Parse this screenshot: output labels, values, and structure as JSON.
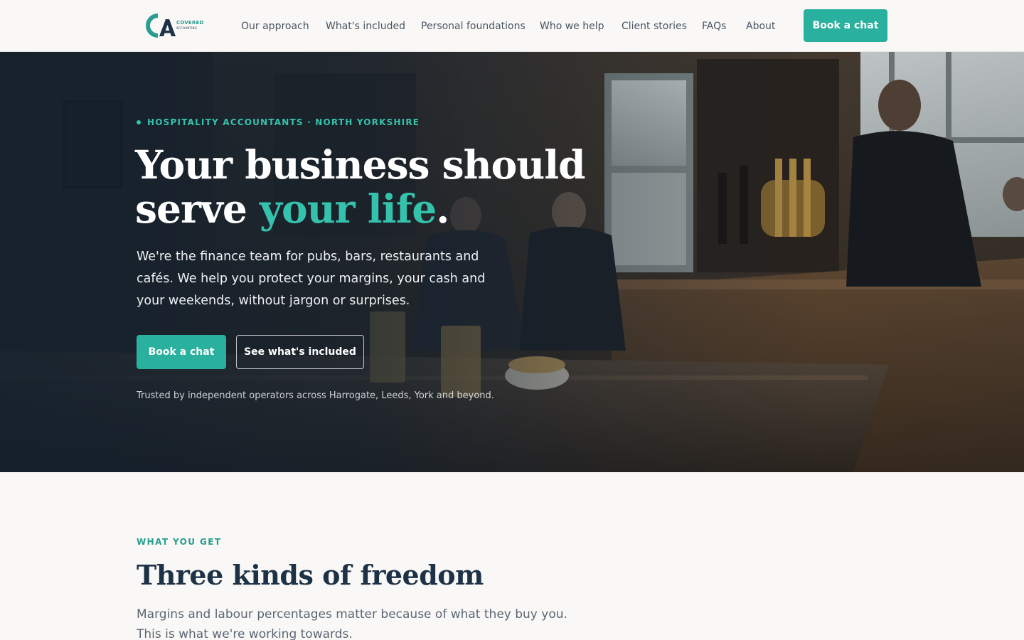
{
  "brand": {
    "monogram": "CA",
    "name": "COVERED",
    "tagline": "ACCOUNTING"
  },
  "nav": {
    "items": [
      {
        "label": "Our approach"
      },
      {
        "label": "What's included"
      },
      {
        "label": "Personal foundations"
      },
      {
        "label": "Who we help"
      },
      {
        "label": "Client stories"
      },
      {
        "label": "FAQs"
      },
      {
        "label": "About"
      }
    ],
    "cta_label": "Book a chat"
  },
  "hero": {
    "eyebrow": "HOSPITALITY ACCOUNTANTS · NORTH YORKSHIRE",
    "title_line1": "Your business should",
    "title_line2_start": "serve ",
    "title_accent": "your life",
    "title_end": ".",
    "lead": "We're the finance team for pubs, bars, restaurants and cafés. We help you protect your margins, your cash and your weekends, without jargon or surprises.",
    "primary_button": "Book a chat",
    "secondary_button": "See what's included",
    "trust_line": "Trusted by independent operators across Harrogate, Leeds, York and beyond."
  },
  "section": {
    "eyebrow": "WHAT YOU GET",
    "title": "Three kinds of freedom",
    "lead": "Margins and labour percentages matter because of what they buy you. This is what we're working towards."
  },
  "colors": {
    "accent": "#2ab09e",
    "accent_light": "#35c2ad",
    "navy": "#1d3247",
    "background": "#f9f8f6"
  }
}
